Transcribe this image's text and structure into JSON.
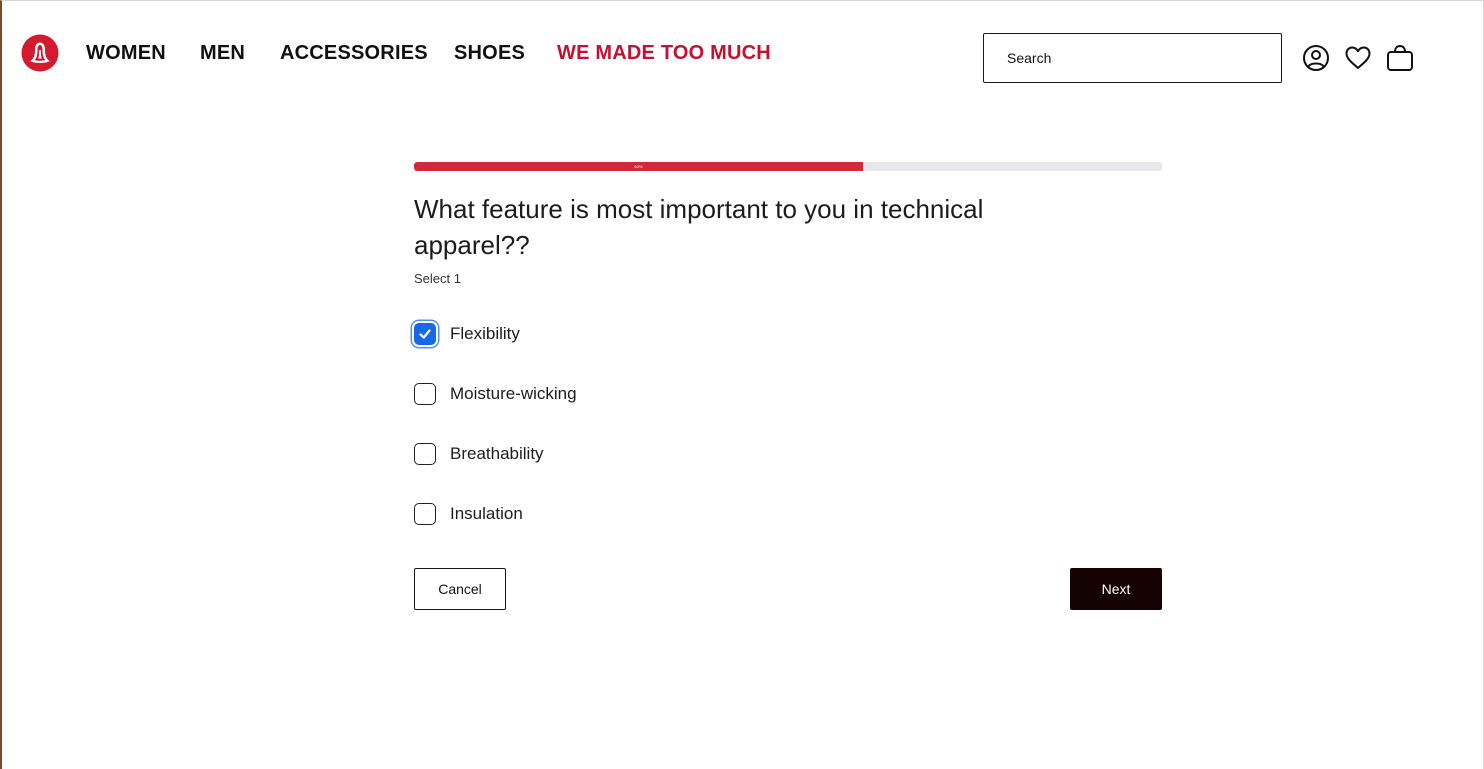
{
  "header": {
    "logo_icon": "lululemon-logo-icon",
    "brand_color": "#c8102e",
    "nav": [
      {
        "label": "WOMEN"
      },
      {
        "label": "MEN"
      },
      {
        "label": "ACCESSORIES"
      },
      {
        "label": "SHOES"
      },
      {
        "label": "WE MADE TOO MUCH"
      }
    ],
    "search": {
      "placeholder": "Search",
      "value": ""
    },
    "icons": [
      "account-icon",
      "wishlist-heart-icon",
      "shopping-bag-icon"
    ]
  },
  "quiz": {
    "progress": {
      "fraction": 0.6,
      "label": "60%",
      "fill_color": "#d22a3a",
      "track_color": "#e6e7eb"
    },
    "question": "What feature is most important to you in technical apparel??",
    "instruction": "Select 1",
    "options": [
      {
        "label": "Flexibility",
        "checked": true
      },
      {
        "label": "Moisture-wicking",
        "checked": false
      },
      {
        "label": "Breathability",
        "checked": false
      },
      {
        "label": "Insulation",
        "checked": false
      }
    ],
    "checkbox_checked_color": "#1769e8",
    "cancel_label": "Cancel",
    "next_label": "Next"
  }
}
